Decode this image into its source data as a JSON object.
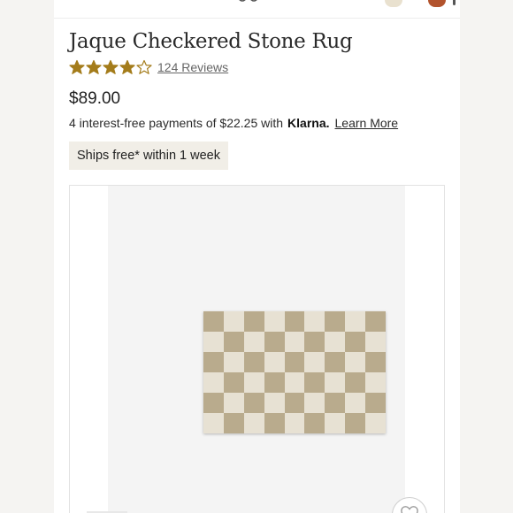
{
  "product": {
    "title": "Jaque Checkered Stone Rug",
    "rating": {
      "stars": 4,
      "max_stars": 5,
      "reviews_label": "124 Reviews"
    },
    "price": "$89.00",
    "installments": {
      "text": "4 interest-free payments of $22.25 with",
      "provider": "Klarna.",
      "link_label": "Learn More"
    },
    "shipping_badge": "Ships free* within 1 week"
  },
  "colors": {
    "star": "#a47c1b",
    "rug_light": "#e7e1d3",
    "rug_dark": "#b9ab8d",
    "account_badge": "#b2532d"
  },
  "icons": {
    "rating": "star-icon",
    "favorite": "heart-icon"
  }
}
